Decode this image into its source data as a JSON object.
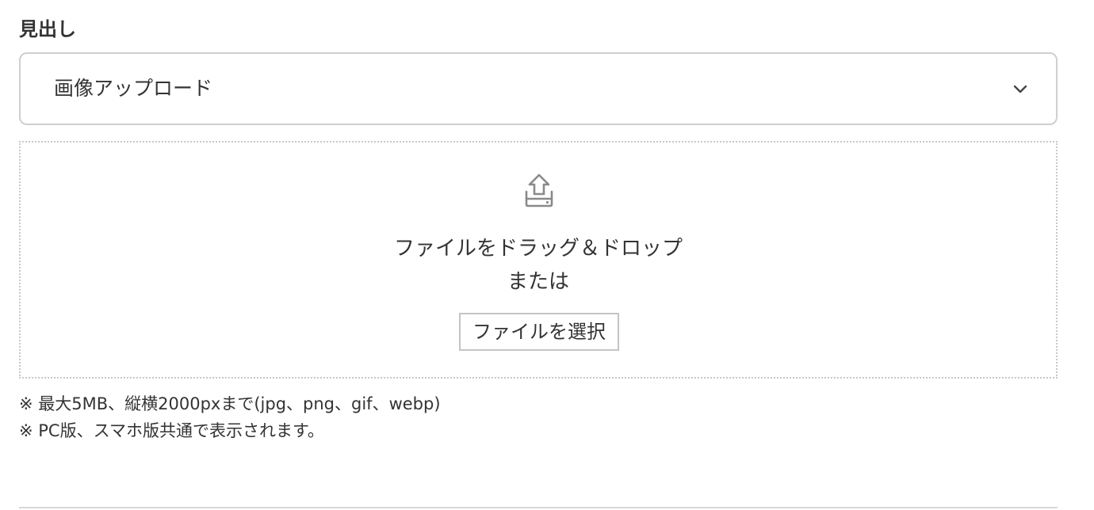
{
  "heading": {
    "label": "見出し"
  },
  "select": {
    "selected_value": "画像アップロード",
    "icon": "chevron-down-icon"
  },
  "upload": {
    "icon": "upload-icon",
    "drop_text_line1": "ファイルをドラッグ＆ドロップ",
    "drop_text_line2": "または",
    "select_file_button": "ファイルを選択"
  },
  "notes": [
    "※ 最大5MB、縦横2000pxまで(jpg、png、gif、webp)",
    "※ PC版、スマホ版共通で表示されます。"
  ],
  "colors": {
    "text": "#333333",
    "border": "#cfcfcf",
    "icon": "#8a8a8a"
  }
}
